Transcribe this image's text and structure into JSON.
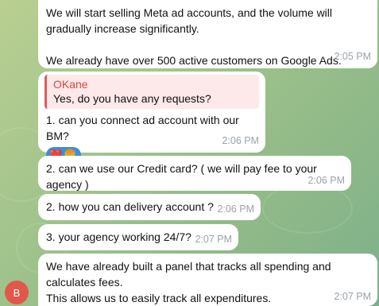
{
  "messages": [
    {
      "text": "We will start selling Meta ad accounts, and the volume will gradually increase significantly.\n\nWe already have over 500 active customers on Google Ads.",
      "time": "2:05 PM"
    },
    {
      "reply_name": "OKane",
      "reply_text": "Yes, do you have any requests?",
      "text": "1. can you connect ad account with our BM?",
      "reactions": [
        "❤️",
        "🍔"
      ],
      "time": "2:06 PM"
    },
    {
      "text": "2. can we use our Credit card? ( we will pay fee to your agency )",
      "time": "2:06 PM"
    },
    {
      "text": "2. how you can delivery account ?",
      "time": "2:06 PM"
    },
    {
      "text": "3. your agency working 24/7?",
      "time": "2:07 PM"
    },
    {
      "text": "We have already built a panel that tracks all spending and calculates fees.\nThis allows us to easily track all expenditures.",
      "time": "2:07 PM"
    }
  ],
  "avatar": {
    "initial": "B",
    "color": "#e2574c"
  },
  "colors": {
    "bubble": "#ffffff",
    "reply_accent": "#e05a5a",
    "reply_bg": "#fde9e9",
    "reaction": "#3b8fd9"
  }
}
